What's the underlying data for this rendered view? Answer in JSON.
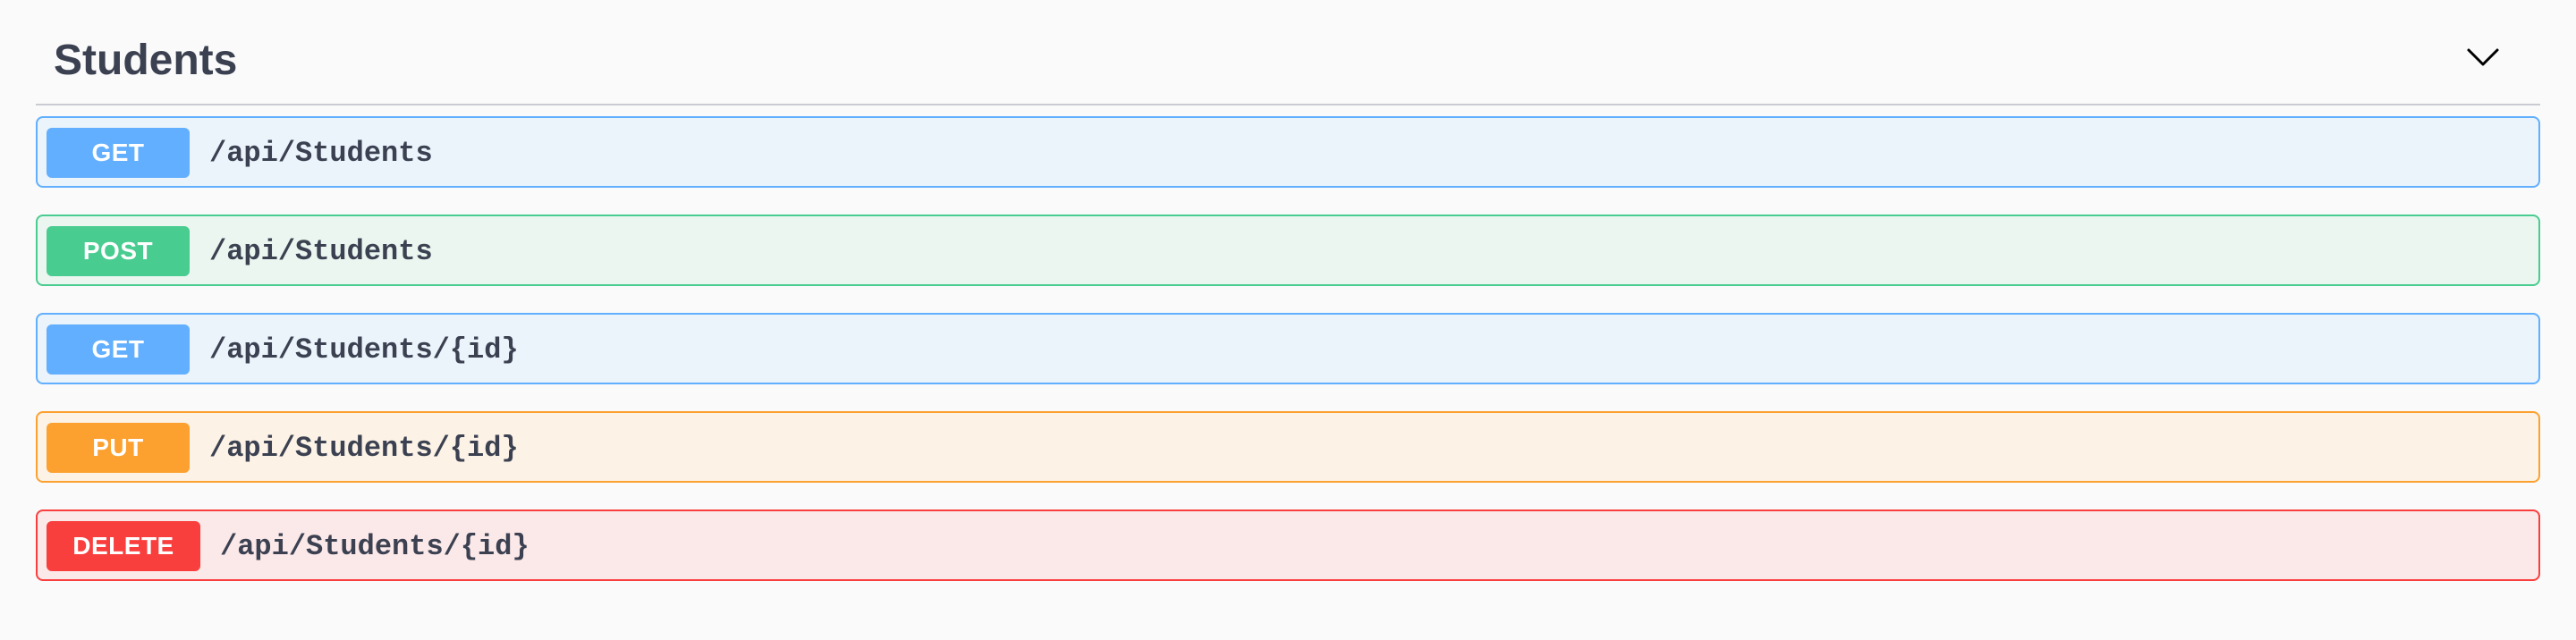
{
  "tag": {
    "title": "Students",
    "toggle_icon": "chevron-down-icon"
  },
  "operations": [
    {
      "method": "GET",
      "path": "/api/Students",
      "color": "#61affe"
    },
    {
      "method": "POST",
      "path": "/api/Students",
      "color": "#49cc90"
    },
    {
      "method": "GET",
      "path": "/api/Students/{id}",
      "color": "#61affe"
    },
    {
      "method": "PUT",
      "path": "/api/Students/{id}",
      "color": "#fca130"
    },
    {
      "method": "DELETE",
      "path": "/api/Students/{id}",
      "color": "#f93e3e"
    }
  ]
}
